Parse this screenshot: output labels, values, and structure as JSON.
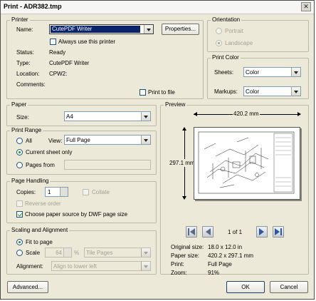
{
  "window": {
    "title": "Print - ADR382.tmp",
    "close_glyph": "✕"
  },
  "printer": {
    "legend": "Printer",
    "name_label": "Name:",
    "name_value": "CutePDF Writer",
    "properties_label": "Properties...",
    "always_use_label": "Always use this printer",
    "always_use_checked": false,
    "status_label": "Status:",
    "status_value": "Ready",
    "type_label": "Type:",
    "type_value": "CutePDF Writer",
    "location_label": "Location:",
    "location_value": "CPW2:",
    "comments_label": "Comments:",
    "print_to_file_label": "Print to file",
    "print_to_file_checked": false
  },
  "orientation": {
    "legend": "Orientation",
    "portrait_label": "Portrait",
    "landscape_label": "Landscape",
    "selected": "Landscape"
  },
  "print_color": {
    "legend": "Print Color",
    "sheets_label": "Sheets:",
    "sheets_value": "Color",
    "markups_label": "Markups:",
    "markups_value": "Color"
  },
  "paper": {
    "legend": "Paper",
    "size_label": "Size:",
    "size_value": "A4"
  },
  "print_range": {
    "legend": "Print Range",
    "all_label": "All",
    "view_label": "View:",
    "view_value": "Full Page",
    "current_sheet_label": "Current sheet only",
    "pages_from_label": "Pages from",
    "selected": "Current sheet only"
  },
  "page_handling": {
    "legend": "Page Handling",
    "copies_label": "Copies:",
    "copies_value": "1",
    "collate_label": "Collate",
    "collate_checked": false,
    "reverse_order_label": "Reverse order",
    "reverse_order_checked": false,
    "paper_source_label": "Choose paper source by DWF page size",
    "paper_source_checked": true
  },
  "scaling": {
    "legend": "Scaling and Alignment",
    "fit_label": "Fit to page",
    "scale_label": "Scale",
    "scale_value": "64",
    "percent": "%",
    "tile_value": "Tile Pages",
    "alignment_label": "Alignment:",
    "alignment_value": "Align to lower left",
    "selected": "Fit to page"
  },
  "preview": {
    "legend": "Preview",
    "width_dim": "420.2 mm",
    "height_dim": "297.1 mm",
    "page_indicator": "1 of 1",
    "original_size_label": "Original size:",
    "original_size_value": "18.0 x 12.0 in",
    "paper_size_label": "Paper size:",
    "paper_size_value": "420.2 x 297.1 mm",
    "print_label": "Print:",
    "print_value": "Full Page",
    "zoom_label": "Zoom:",
    "zoom_value": "91%"
  },
  "footer": {
    "advanced_label": "Advanced...",
    "ok_label": "OK",
    "cancel_label": "Cancel"
  }
}
